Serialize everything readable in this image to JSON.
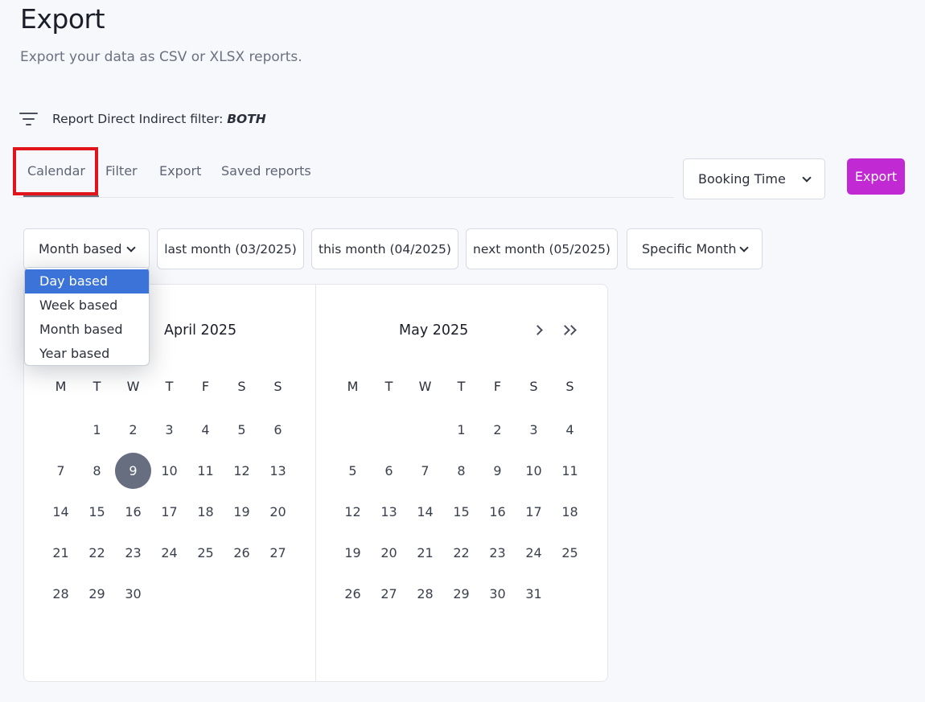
{
  "header": {
    "title": "Export",
    "subtitle": "Export your data as CSV or XLSX reports."
  },
  "filter": {
    "icon": "filter-lines-icon",
    "label": "Report Direct Indirect filter:",
    "value": "BOTH"
  },
  "tabs": [
    {
      "label": "Calendar",
      "active": true
    },
    {
      "label": "Filter",
      "active": false
    },
    {
      "label": "Export",
      "active": false
    },
    {
      "label": "Saved reports",
      "active": false
    }
  ],
  "time_select": {
    "value": "Booking Time"
  },
  "export_button": {
    "label": "Export",
    "color": "#c12ad3"
  },
  "period_mode": {
    "value": "Month based",
    "options": [
      "Day based",
      "Week based",
      "Month based",
      "Year based"
    ],
    "highlighted": "Day based"
  },
  "quick_ranges": [
    "last month (03/2025)",
    "this month (04/2025)",
    "next month (05/2025)"
  ],
  "specific_select": {
    "value": "Specific Month"
  },
  "calendar": {
    "weekdays": [
      "M",
      "T",
      "W",
      "T",
      "F",
      "S",
      "S"
    ],
    "months": [
      {
        "title": "April 2025",
        "first_weekday": 1,
        "days": 30,
        "selected": 9
      },
      {
        "title": "May 2025",
        "first_weekday": 3,
        "days": 31,
        "selected": null
      }
    ],
    "selected_color": "#676e80"
  }
}
